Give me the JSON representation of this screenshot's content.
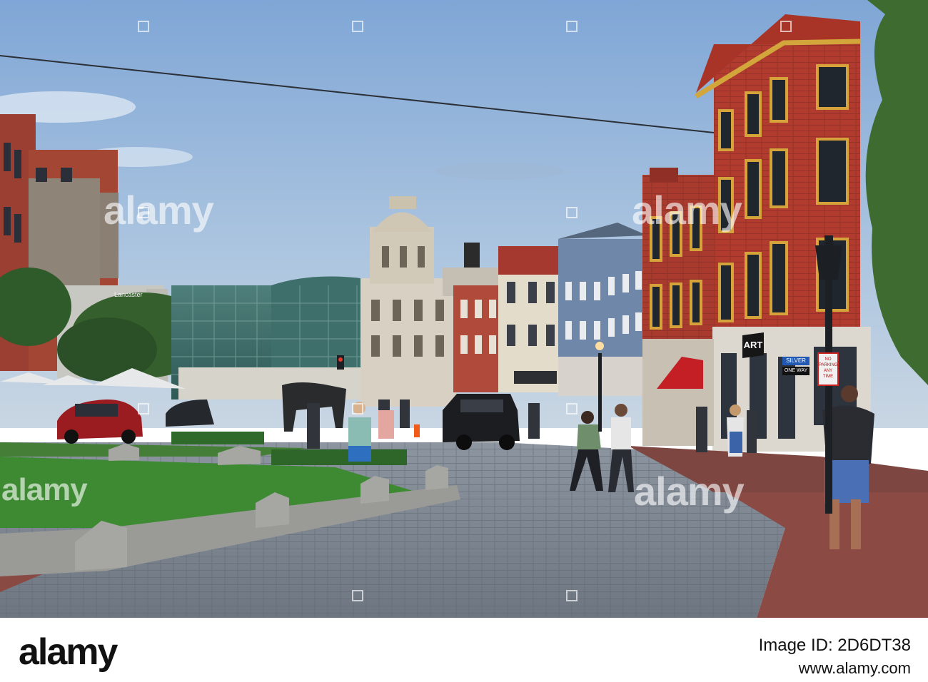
{
  "watermark": {
    "brand": "alamy"
  },
  "footer": {
    "logo": "alamy",
    "image_id_line": "Image ID: 2D6DT38",
    "url": "www.alamy.com"
  },
  "signs": {
    "art": "ART",
    "street": "SILVER",
    "one_way": "ONE WAY",
    "no_parking": "NO PARKING ANY TIME",
    "store": "Lancaster"
  }
}
